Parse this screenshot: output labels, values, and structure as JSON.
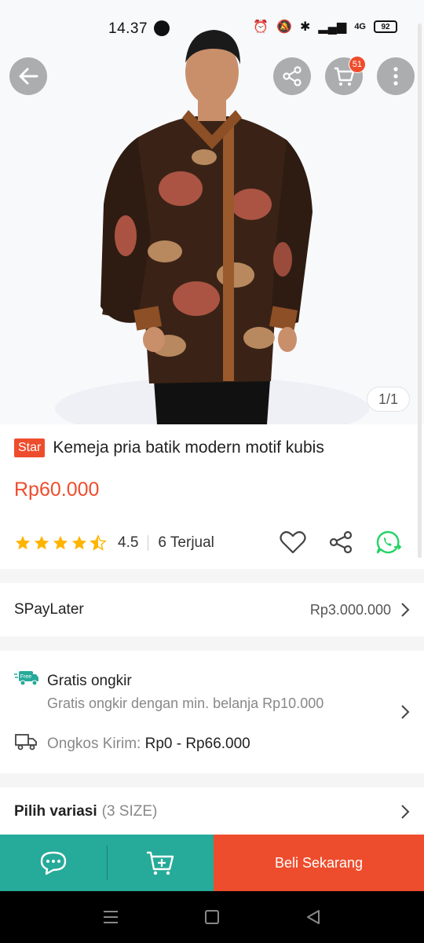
{
  "status_bar": {
    "time": "14.37",
    "network": "4G",
    "battery": "92"
  },
  "header": {
    "cart_count": "51"
  },
  "image_pager": "1/1",
  "product": {
    "badge": "Star",
    "title": "Kemeja pria batik modern motif kubis",
    "price": "Rp60.000",
    "rating": 4.5,
    "rating_label": "4.5",
    "sold": "6 Terjual"
  },
  "paylater": {
    "label": "SPayLater",
    "value": "Rp3.000.000"
  },
  "shipping": {
    "free_tag": "Free",
    "title": "Gratis ongkir",
    "subtitle": "Gratis ongkir dengan min. belanja Rp10.000",
    "cost_label": "Ongkos Kirim: ",
    "cost_value": "Rp0 - Rp66.000"
  },
  "variation": {
    "label": "Pilih variasi",
    "detail": "(3 SIZE)"
  },
  "action_bar": {
    "buy_label": "Beli Sekarang"
  },
  "colors": {
    "brand": "#ee4d2d",
    "teal": "#26aa99",
    "star": "#ffb400",
    "whatsapp": "#25d366"
  }
}
